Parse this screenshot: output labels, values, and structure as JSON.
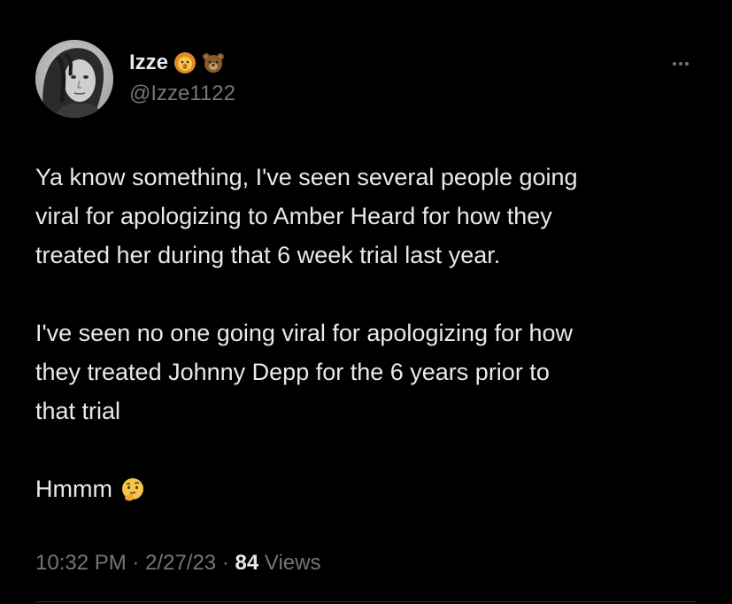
{
  "author": {
    "display_name": "Izze",
    "handle": "@Izze1122",
    "badges": [
      "lion-face-icon",
      "bear-face-icon"
    ],
    "avatar": "avatar-photo"
  },
  "tweet": {
    "paragraphs": [
      [
        "Ya know something, I've seen several people going",
        "viral for apologizing to Amber Heard for how they",
        "treated her during that 6 week trial last year."
      ],
      [
        "I've seen no one going viral for apologizing for how",
        "they treated Johnny Depp for the 6 years prior to",
        "that trial"
      ]
    ],
    "closing_text": "Hmmm",
    "closing_icon": "thinking-face-icon"
  },
  "meta": {
    "time": "10:32 PM",
    "separator": "·",
    "date": "2/27/23",
    "views_count": "84",
    "views_label": "Views"
  },
  "more_icon": "more-options-icon",
  "colors": {
    "background": "#000000",
    "primary_text": "#e7e9ea",
    "secondary_text": "#71767b"
  }
}
